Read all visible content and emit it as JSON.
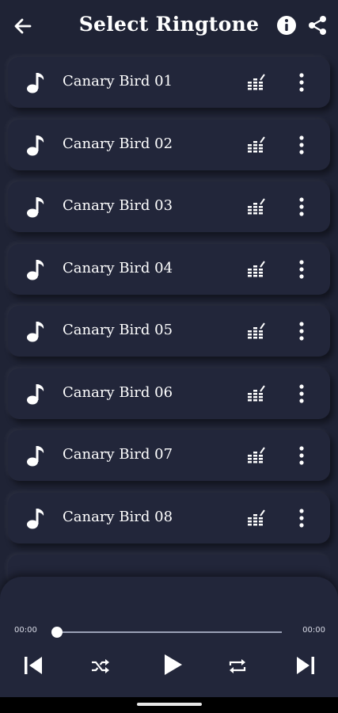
{
  "header": {
    "title": "Select Ringtone",
    "back_icon": "arrow-left-icon",
    "info_icon": "info-circle-icon",
    "share_icon": "share-icon"
  },
  "ringtones": [
    {
      "name": "Canary Bird 01"
    },
    {
      "name": "Canary Bird 02"
    },
    {
      "name": "Canary Bird 03"
    },
    {
      "name": "Canary Bird 04"
    },
    {
      "name": "Canary Bird 05"
    },
    {
      "name": "Canary Bird 06"
    },
    {
      "name": "Canary Bird 07"
    },
    {
      "name": "Canary Bird 08"
    }
  ],
  "item_icons": {
    "leading": "music-note-icon",
    "equalizer": "equalizer-icon",
    "menu": "more-vertical-icon"
  },
  "player": {
    "current_time": "00:00",
    "duration": "00:00",
    "progress": 0,
    "controls": [
      "skip-previous-icon",
      "shuffle-icon",
      "play-icon",
      "repeat-icon",
      "skip-next-icon"
    ]
  },
  "colors": {
    "background": "#1f2335",
    "card": "#22263a",
    "text": "#ffffff"
  }
}
